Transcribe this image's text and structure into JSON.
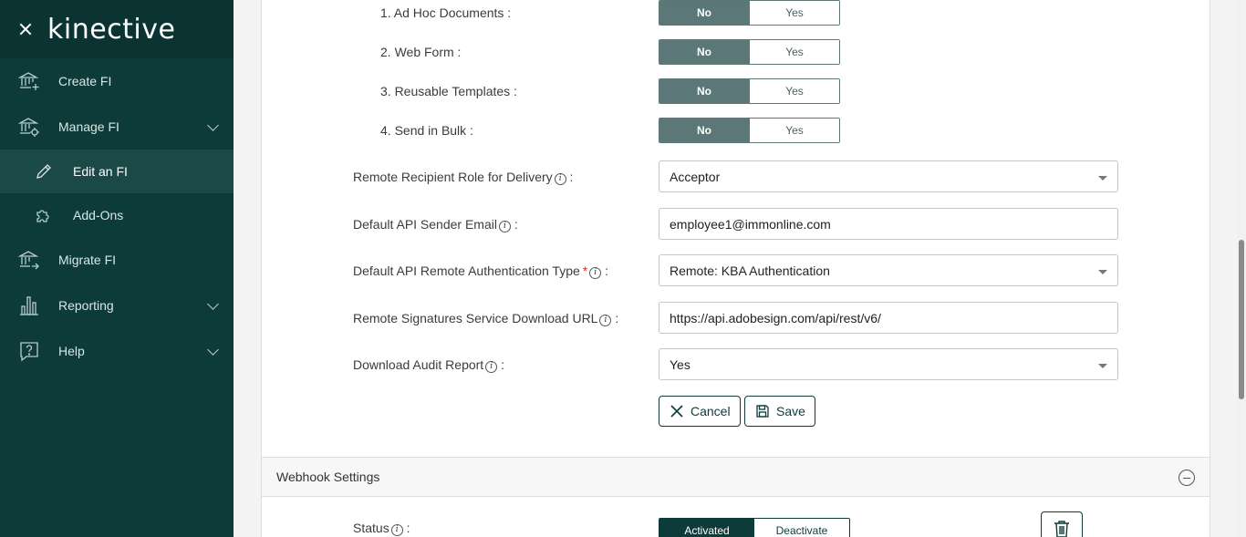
{
  "brand": {
    "logo": "kinective"
  },
  "sidebar": {
    "items": [
      {
        "label": "Create FI",
        "icon": "bank-plus-icon"
      },
      {
        "label": "Manage FI",
        "icon": "bank-gear-icon"
      },
      {
        "label": "Edit an FI",
        "icon": "pencil-icon"
      },
      {
        "label": "Add-Ons",
        "icon": "puzzle-icon"
      },
      {
        "label": "Migrate FI",
        "icon": "bank-arrow-icon"
      },
      {
        "label": "Reporting",
        "icon": "bar-chart-icon"
      },
      {
        "label": "Help",
        "icon": "question-icon"
      }
    ]
  },
  "toggles": [
    {
      "label": "1. Ad Hoc Documents :",
      "no": "No",
      "yes": "Yes",
      "selected": "No"
    },
    {
      "label": "2. Web Form :",
      "no": "No",
      "yes": "Yes",
      "selected": "No"
    },
    {
      "label": "3. Reusable Templates :",
      "no": "No",
      "yes": "Yes",
      "selected": "No"
    },
    {
      "label": "4. Send in Bulk :",
      "no": "No",
      "yes": "Yes",
      "selected": "No"
    }
  ],
  "fields": {
    "recipient_role": {
      "label": "Remote Recipient Role for Delivery",
      "value": "Acceptor"
    },
    "sender_email": {
      "label": "Default API Sender Email",
      "value": "employee1@immonline.com"
    },
    "auth_type": {
      "label": "Default API Remote Authentication Type",
      "required_mark": "*",
      "value": "Remote: KBA Authentication"
    },
    "download_url": {
      "label": "Remote Signatures Service Download URL",
      "value": "https://api.adobesign.com/api/rest/v6/"
    },
    "audit_report": {
      "label": "Download Audit Report",
      "value": "Yes"
    }
  },
  "info_glyph": "i",
  "colon": ":",
  "buttons": {
    "cancel": "Cancel",
    "save": "Save"
  },
  "webhook": {
    "title": "Webhook Settings",
    "status_label": "Status",
    "activated": "Activated",
    "deactivate": "Deactivate",
    "selected": "Activated"
  },
  "colors": {
    "sidebar": "#0d3b3a",
    "toggle_on": "#5b7778",
    "accent": "#0d3b3a"
  }
}
